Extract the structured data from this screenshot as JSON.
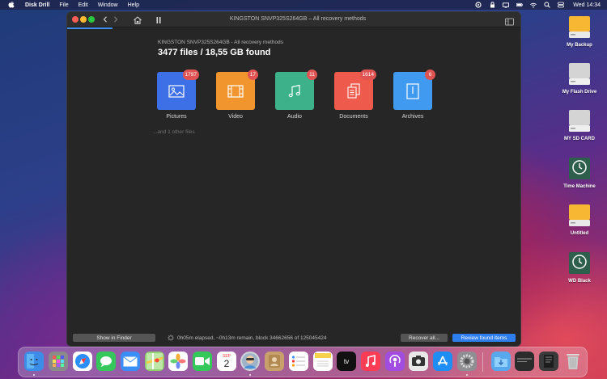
{
  "menubar": {
    "app_name": "Disk Drill",
    "items": [
      "File",
      "Edit",
      "Window",
      "Help"
    ],
    "clock": "Wed 14:34"
  },
  "window": {
    "title": "KINGSTON  SNVP325S264GB – All recovery methods",
    "disk_name": "KINGSTON  SNVP325S264GB - All recovery methods",
    "found_summary": "3477 files / 18,55 GB found",
    "categories": [
      {
        "label": "Pictures",
        "count": "1797",
        "color": "#3d6fe6",
        "icon": "picture-icon"
      },
      {
        "label": "Video",
        "count": "17",
        "color": "#f1962e",
        "icon": "film-icon"
      },
      {
        "label": "Audio",
        "count": "11",
        "color": "#3db28a",
        "icon": "music-note-icon"
      },
      {
        "label": "Documents",
        "count": "1614",
        "color": "#ee5b4c",
        "icon": "documents-icon"
      },
      {
        "label": "Archives",
        "count": "6",
        "color": "#3f9af0",
        "icon": "archive-icon"
      }
    ],
    "other_files": "...and 1 other files",
    "footer": {
      "show_in_finder": "Show in Finder",
      "status": "0h05m elapsed, ~0h13m remain, block 34662656 of 125045424",
      "recover_all": "Recover all...",
      "review_found_items": "Review found items"
    }
  },
  "desktop": {
    "icons": [
      {
        "label": "My Backup",
        "kind": "orange-drive"
      },
      {
        "label": "My Flash Drive",
        "kind": "gray-drive"
      },
      {
        "label": "MY SD CARD",
        "kind": "gray-drive"
      },
      {
        "label": "Time Machine",
        "kind": "time-machine"
      },
      {
        "label": "Untitled",
        "kind": "orange-drive"
      },
      {
        "label": "WD Black",
        "kind": "time-machine"
      }
    ]
  },
  "dock": {
    "apps": [
      "finder",
      "launchpad",
      "safari",
      "messages",
      "mail",
      "maps",
      "photos",
      "facetime",
      "calendar",
      "disk-drill",
      "contacts",
      "reminders",
      "notes",
      "apple-tv",
      "music",
      "podcasts",
      "screenshot",
      "app-store",
      "system-preferences",
      "downloads",
      "recent-item",
      "recent-item-2",
      "trash"
    ],
    "calendar_month": "SEP",
    "calendar_day": "2",
    "tv_label": "tv"
  }
}
